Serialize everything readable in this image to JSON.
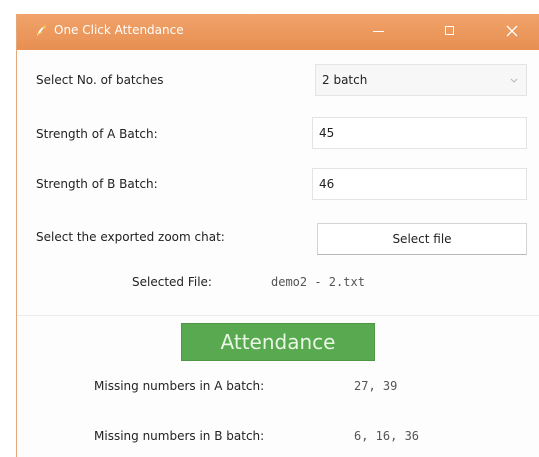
{
  "window": {
    "title": "One Click Attendance",
    "icons": {
      "app": "python-feather-icon",
      "minimize": "minimize-icon",
      "maximize": "maximize-icon",
      "close": "close-icon"
    },
    "colors": {
      "titlebar": "#e88f52",
      "attendance_button": "#58a94f"
    }
  },
  "form": {
    "batches_label": "Select No. of batches",
    "batches_value": "2 batch",
    "a_strength_label": "Strength of A Batch:",
    "a_strength_value": "45",
    "b_strength_label": "Strength of B Batch:",
    "b_strength_value": "46",
    "chat_label": "Select the exported zoom chat:",
    "select_file_label": "Select file",
    "selected_file_label": "Selected File:",
    "selected_file_value": "demo2 - 2.txt"
  },
  "actions": {
    "attendance_label": "Attendance"
  },
  "results": {
    "missing_a_label": "Missing numbers in A batch:",
    "missing_a_value": "27, 39",
    "missing_b_label": "Missing numbers in B batch:",
    "missing_b_value": "6, 16, 36"
  }
}
